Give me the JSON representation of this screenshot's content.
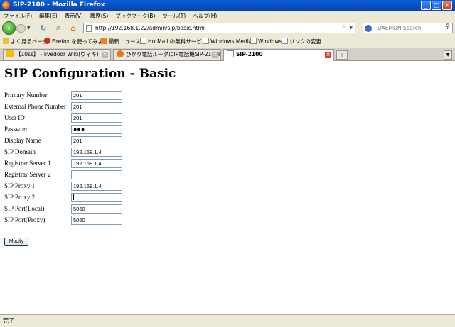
{
  "window": {
    "title": "SIP-2100 - Mozilla Firefox",
    "min": "_",
    "max": "□",
    "close": "×"
  },
  "menu": [
    "ファイル(F)",
    "編集(E)",
    "表示(V)",
    "履歴(S)",
    "ブックマーク(B)",
    "ツール(T)",
    "ヘルプ(H)"
  ],
  "nav": {
    "url": "http://192.168.1.22/admin/sip/basic.html",
    "search_placeholder": "DAEMON Search"
  },
  "bookmarks": [
    "よく見るページ",
    "Firefox を使ってみよう",
    "最新ニュース",
    "HotMail の無料サービス",
    "Windows Media",
    "Windows",
    "リンクの変更"
  ],
  "tabs": [
    {
      "label": "【10ss】 - livedoor Wiki(ウィキ)",
      "active": false
    },
    {
      "label": "ひかり電話ルータにIP電話機SIP-2100P...",
      "active": false
    },
    {
      "label": "SIP-2100",
      "active": true
    }
  ],
  "page": {
    "title": "SIP Configuration - Basic",
    "fields": [
      {
        "label": "Primary Number",
        "value": "201"
      },
      {
        "label": "External Phone Number",
        "value": "201"
      },
      {
        "label": "User ID",
        "value": "201"
      },
      {
        "label": "Password",
        "value": "●●●"
      },
      {
        "label": "Display Name",
        "value": "201"
      },
      {
        "label": "SIP Domain",
        "value": "192.168.1.4"
      },
      {
        "label": "Registrar Server 1",
        "value": "192.168.1.4"
      },
      {
        "label": "Registrar Server 2",
        "value": ""
      },
      {
        "label": "SIP Proxy 1",
        "value": "192.168.1.4"
      },
      {
        "label": "SIP Proxy 2",
        "value": ""
      },
      {
        "label": "SIP Port(Local)",
        "value": "5060"
      },
      {
        "label": "SIP Port(Proxy)",
        "value": "5060"
      }
    ],
    "modify_label": "Modify"
  },
  "status": {
    "text": "完了"
  },
  "colors": {
    "titlebar": "#0a5fd8",
    "chrome": "#ece9d8",
    "input_border": "#7f9db9"
  }
}
